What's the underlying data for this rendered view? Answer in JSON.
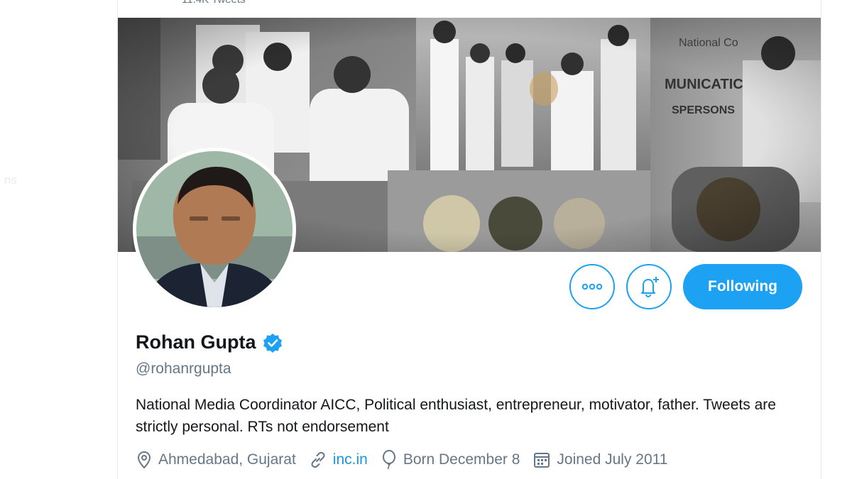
{
  "header": {
    "tweets_count": "11.4K Tweets"
  },
  "left_panel": {
    "ghost_text": "ns"
  },
  "actions": {
    "more_icon": "more-dots-icon",
    "notify_icon": "bell-plus-icon",
    "following_label": "Following"
  },
  "profile": {
    "name": "Rohan Gupta",
    "verified_icon": "verified-badge-icon",
    "handle": "@rohanrgupta",
    "bio": "National Media Coordinator AICC, Political enthusiast, entrepreneur, motivator, father. Tweets are strictly personal. RTs not endorsement",
    "location": "Ahmedabad, Gujarat",
    "website": "inc.in",
    "birthday": "Born December 8",
    "joined": "Joined July 2011"
  },
  "colors": {
    "accent": "#1da1f2",
    "link": "#1b95e0",
    "secondary_text": "#657786",
    "primary_text": "#14171a"
  }
}
